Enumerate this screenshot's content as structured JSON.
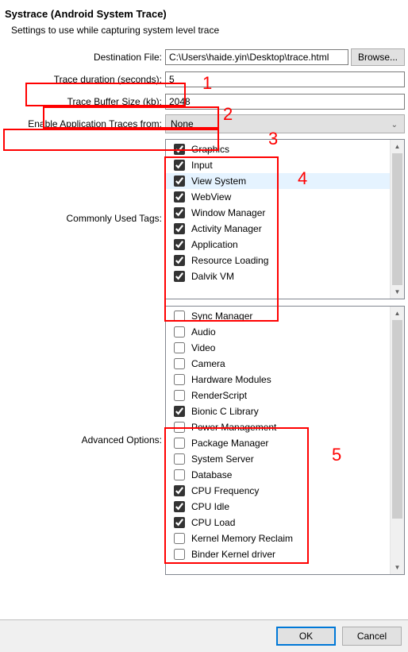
{
  "title": "Systrace (Android System Trace)",
  "subtitle": "Settings to use while capturing system level trace",
  "destination": {
    "label": "Destination File:",
    "value": "C:\\Users\\haide.yin\\Desktop\\trace.html",
    "browse": "Browse..."
  },
  "duration": {
    "label": "Trace duration (seconds):",
    "value": "5"
  },
  "buffer": {
    "label": "Trace Buffer Size (kb):",
    "value": "2048"
  },
  "appTraces": {
    "label": "Enable Application Traces from:",
    "value": "None"
  },
  "commonTags": {
    "label": "Commonly Used Tags:",
    "items": [
      {
        "label": "Graphics",
        "checked": true
      },
      {
        "label": "Input",
        "checked": true
      },
      {
        "label": "View System",
        "checked": true,
        "selected": true
      },
      {
        "label": "WebView",
        "checked": true
      },
      {
        "label": "Window Manager",
        "checked": true
      },
      {
        "label": "Activity Manager",
        "checked": true
      },
      {
        "label": "Application",
        "checked": true
      },
      {
        "label": "Resource Loading",
        "checked": true
      },
      {
        "label": "Dalvik VM",
        "checked": true
      }
    ]
  },
  "advancedOptions": {
    "label": "Advanced Options:",
    "items": [
      {
        "label": "Sync Manager",
        "checked": false
      },
      {
        "label": "Audio",
        "checked": false
      },
      {
        "label": "Video",
        "checked": false
      },
      {
        "label": "Camera",
        "checked": false
      },
      {
        "label": "Hardware Modules",
        "checked": false
      },
      {
        "label": "RenderScript",
        "checked": false
      },
      {
        "label": "Bionic C Library",
        "checked": true
      },
      {
        "label": "Power Management",
        "checked": false
      },
      {
        "label": "Package Manager",
        "checked": false
      },
      {
        "label": "System Server",
        "checked": false
      },
      {
        "label": "Database",
        "checked": false
      },
      {
        "label": "CPU Frequency",
        "checked": true
      },
      {
        "label": "CPU Idle",
        "checked": true
      },
      {
        "label": "CPU Load",
        "checked": true
      },
      {
        "label": "Kernel Memory Reclaim",
        "checked": false
      },
      {
        "label": "Binder Kernel driver",
        "checked": false
      }
    ]
  },
  "buttons": {
    "ok": "OK",
    "cancel": "Cancel"
  },
  "annotations": [
    "1",
    "2",
    "3",
    "4",
    "5"
  ]
}
